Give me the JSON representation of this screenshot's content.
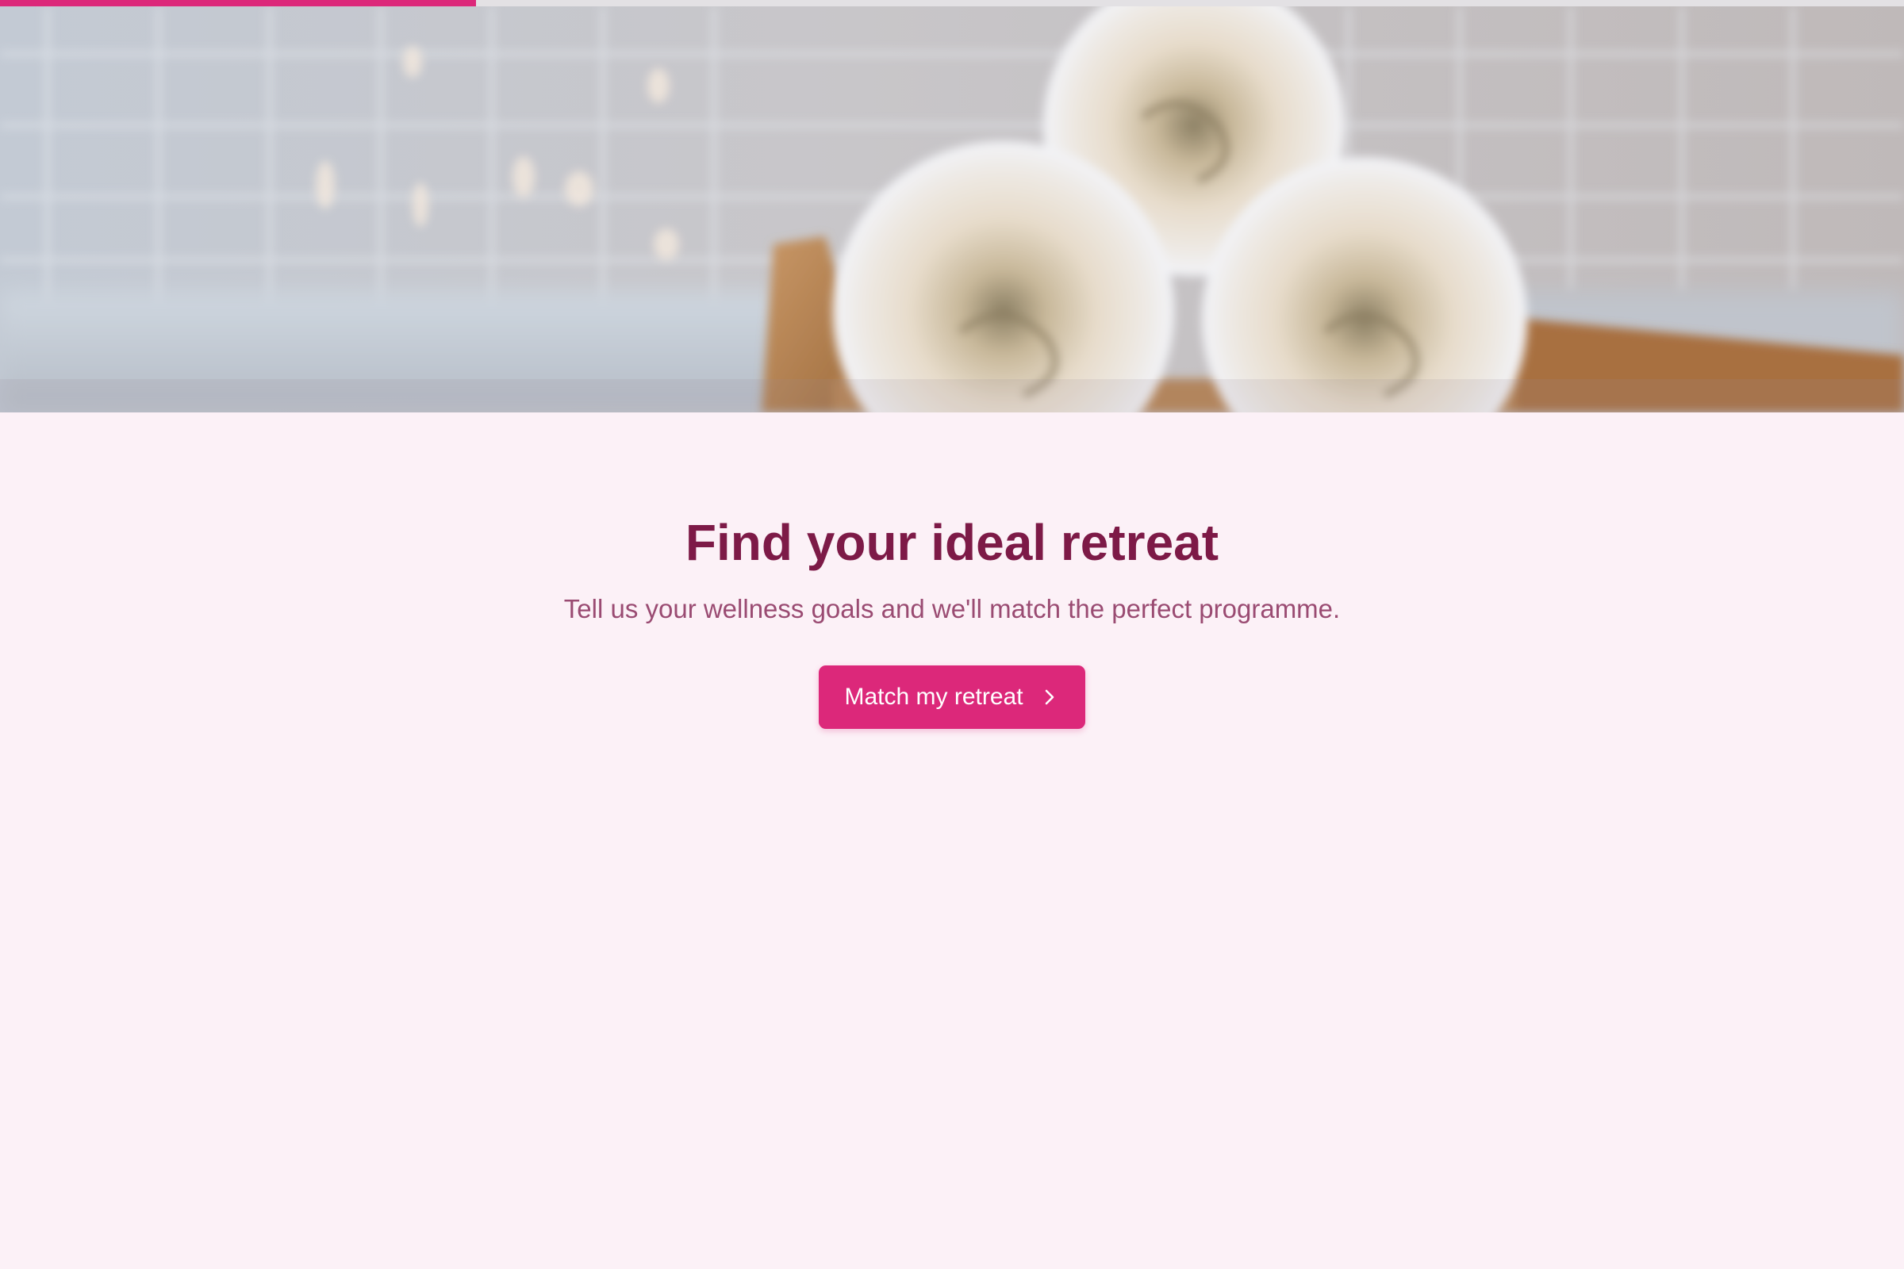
{
  "progress": {
    "fraction": 0.25,
    "fill_color": "#dc287a",
    "track_color": "#e3e1e4"
  },
  "hero": {
    "image": "rolled-white-towels-on-wooden-tray"
  },
  "main": {
    "headline": "Find your ideal retreat",
    "subtitle": "Tell us your wellness goals and we'll match the perfect programme.",
    "cta_label": "Match my retreat",
    "cta_icon": "chevron-right-icon"
  },
  "colors": {
    "background": "#fcf1f7",
    "accent": "#dc287a",
    "headline": "#7d1a47",
    "subtitle": "#9a4b72"
  }
}
